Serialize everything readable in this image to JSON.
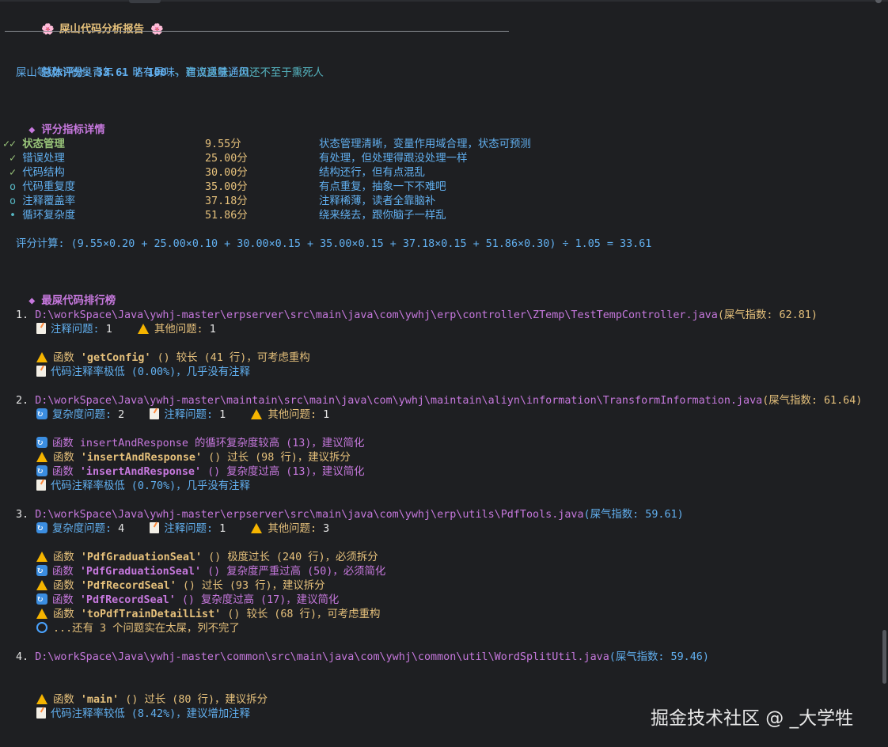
{
  "header": {
    "flower_left": "🌸",
    "title": "屎山代码分析报告",
    "flower_right": "🌸"
  },
  "summary": {
    "score_label": "总体评分: 33.61 / 100",
    "score_comment": " - 有点臭味，但还不至于熏死人",
    "level_line": "屎山等级: 微臭青年 - 略有异味，建议适量通风"
  },
  "metrics_section": {
    "bullet": "◆",
    "title": "评分指标详情",
    "rows": [
      {
        "mark": "✓✓",
        "name": "状态管理",
        "score": "9.55分",
        "desc": "状态管理清晰，变量作用域合理，状态可预测"
      },
      {
        "mark": " ✓",
        "name": "错误处理",
        "score": "25.00分",
        "desc": "有处理，但处理得跟没处理一样"
      },
      {
        "mark": " ✓",
        "name": "代码结构",
        "score": "30.00分",
        "desc": "结构还行，但有点混乱"
      },
      {
        "mark": " o",
        "name": "代码重复度",
        "score": "35.00分",
        "desc": "有点重复，抽象一下不难吧"
      },
      {
        "mark": " o",
        "name": "注释覆盖率",
        "score": "37.18分",
        "desc": "注释稀薄，读者全靠脑补"
      },
      {
        "mark": " •",
        "name": "循环复杂度",
        "score": "51.86分",
        "desc": "绕来绕去，跟你脑子一样乱"
      }
    ],
    "formula": "评分计算: (9.55×0.20 + 25.00×0.10 + 30.00×0.15 + 35.00×0.15 + 37.18×0.15 + 51.86×0.30) ÷ 1.05 = 33.61"
  },
  "ranking_section": {
    "bullet": "◆",
    "title": "最屎代码排行榜",
    "files": [
      {
        "num": "1.",
        "path": "D:\\workSpace\\Java\\ywhj-master\\erpserver\\src\\main\\java\\com\\ywhj\\erp\\controller\\ZTemp\\TestTempController.java",
        "index": "(屎气指数: 62.81)",
        "counts": [
          {
            "icon": "memo",
            "label": "注释问题: ",
            "value": "1"
          },
          {
            "icon": "warn",
            "label": "其他问题: ",
            "value": "1"
          }
        ],
        "issues": [
          {
            "icon": "warn",
            "prefix": "函数 ",
            "func": "'getConfig'",
            "text": " () 较长 (41 行)，可考虑重构"
          },
          {
            "icon": "memo",
            "prefix": "代码注释率极低 (0.00%)，几乎没有注释",
            "func": "",
            "text": ""
          }
        ]
      },
      {
        "num": "2.",
        "path": "D:\\workSpace\\Java\\ywhj-master\\maintain\\src\\main\\java\\com\\ywhj\\maintain\\aliyn\\information\\TransformInformation.java",
        "index": "(屎气指数: 61.64)",
        "counts": [
          {
            "icon": "cycle",
            "label": "复杂度问题: ",
            "value": "2"
          },
          {
            "icon": "memo",
            "label": "注释问题: ",
            "value": "1"
          },
          {
            "icon": "warn",
            "label": "其他问题: ",
            "value": "1"
          }
        ],
        "issues": [
          {
            "icon": "cycle",
            "prefix": "函数 insertAndResponse 的循环复杂度较高 (13)，建议简化",
            "func": "",
            "text": ""
          },
          {
            "icon": "warn",
            "prefix": "函数 ",
            "func": "'insertAndResponse'",
            "text": " () 过长 (98 行)，建议拆分"
          },
          {
            "icon": "cycle",
            "prefix": "函数 ",
            "func": "'insertAndResponse'",
            "text": " () 复杂度过高 (13)，建议简化"
          },
          {
            "icon": "memo",
            "prefix": "代码注释率极低 (0.70%)，几乎没有注释",
            "func": "",
            "text": ""
          }
        ]
      },
      {
        "num": "3.",
        "path": "D:\\workSpace\\Java\\ywhj-master\\erpserver\\src\\main\\java\\com\\ywhj\\erp\\utils\\PdfTools.java",
        "index": "(屎气指数: 59.61)",
        "counts": [
          {
            "icon": "cycle",
            "label": "复杂度问题: ",
            "value": "4"
          },
          {
            "icon": "memo",
            "label": "注释问题: ",
            "value": "1"
          },
          {
            "icon": "warn",
            "label": "其他问题: ",
            "value": "3"
          }
        ],
        "issues": [
          {
            "icon": "warn",
            "prefix": "函数 ",
            "func": "'PdfGraduationSeal'",
            "text": " () 极度过长 (240 行)，必须拆分"
          },
          {
            "icon": "cycle",
            "prefix": "函数 ",
            "func": "'PdfGraduationSeal'",
            "text": " () 复杂度严重过高 (50)，必须简化"
          },
          {
            "icon": "warn",
            "prefix": "函数 ",
            "func": "'PdfRecordSeal'",
            "text": " () 过长 (93 行)，建议拆分"
          },
          {
            "icon": "cycle",
            "prefix": "函数 ",
            "func": "'PdfRecordSeal'",
            "text": " () 复杂度过高 (17)，建议简化"
          },
          {
            "icon": "warn",
            "prefix": "函数 ",
            "func": "'toPdfTrainDetailList'",
            "text": " () 较长 (68 行)，可考虑重构"
          },
          {
            "icon": "search",
            "prefix": "...还有 3 个问题实在太屎，列不完了",
            "func": "",
            "text": ""
          }
        ]
      },
      {
        "num": "4.",
        "path": "D:\\workSpace\\Java\\ywhj-master\\common\\src\\main\\java\\com\\ywhj\\common\\util\\WordSplitUtil.java",
        "index": "(屎气指数: 59.46)",
        "counts": [],
        "issues": [
          {
            "icon": "warn",
            "prefix": "函数 ",
            "func": "'main'",
            "text": " () 过长 (80 行)，建议拆分"
          },
          {
            "icon": "memo",
            "prefix": "代码注释率较低 (8.42%)，建议增加注释",
            "func": "",
            "text": ""
          }
        ]
      }
    ]
  },
  "watermark": "掘金技术社区 @ _大学牲",
  "colors": {
    "background": "#1e1f22",
    "title_yellow": "#e5c07b",
    "path_magenta": "#c678dd",
    "text_blue": "#61afef",
    "text_cyan": "#56b6c2",
    "warn_orange": "#f5b400"
  }
}
